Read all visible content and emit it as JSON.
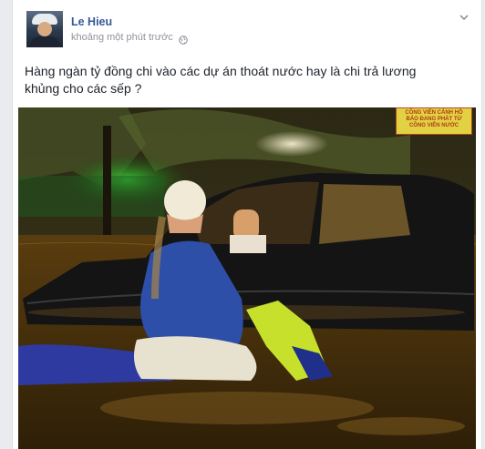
{
  "post": {
    "author": "Le Hieu",
    "timestamp": "khoảng một phút trước",
    "privacy_icon": "globe-icon",
    "options_icon": "chevron-down-icon",
    "text": "Hàng ngàn tỷ đồng chi vào các dự án thoát nước hay là chi trả lương khủng cho các sếp ?"
  },
  "photo": {
    "sign_text": "CÔNG VIÊN CẢNH HỒ\nBÁO ĐANG PHÁT TỪ\nCÔNG VIÊN NƯỚC"
  },
  "colors": {
    "author_link": "#365899",
    "meta_grey": "#90949c",
    "text": "#1d2129"
  }
}
